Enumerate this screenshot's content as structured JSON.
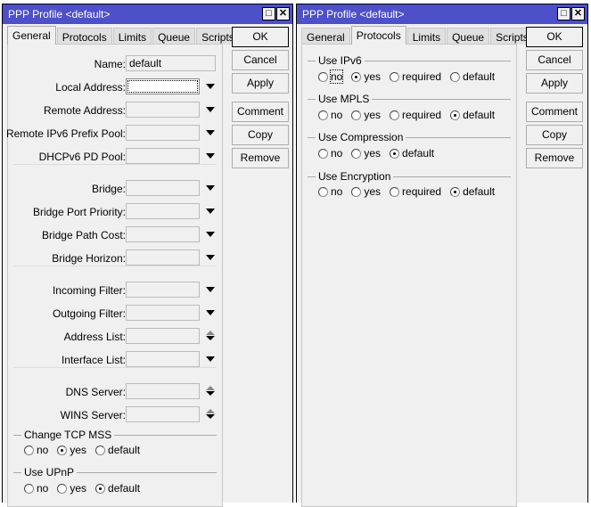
{
  "windows": [
    {
      "title": "PPP Profile <default>",
      "tabs": [
        "General",
        "Protocols",
        "Limits",
        "Queue",
        "Scripts"
      ],
      "active_tab": 0
    },
    {
      "title": "PPP Profile <default>",
      "tabs": [
        "General",
        "Protocols",
        "Limits",
        "Queue",
        "Scripts"
      ],
      "active_tab": 1
    }
  ],
  "buttons": [
    "OK",
    "Cancel",
    "Apply",
    "Comment",
    "Copy",
    "Remove"
  ],
  "title_buttons": {
    "maximize": "□",
    "close": "✕"
  },
  "general": {
    "fields": [
      {
        "label": "Name:",
        "value": "default",
        "kind": "text"
      },
      {
        "label": "Local Address:",
        "value": "",
        "kind": "dropdown",
        "focused": true
      },
      {
        "label": "Remote Address:",
        "value": "",
        "kind": "dropdown"
      },
      {
        "label": "Remote IPv6 Prefix Pool:",
        "value": "",
        "kind": "dropdown"
      },
      {
        "label": "DHCPv6 PD Pool:",
        "value": "",
        "kind": "dropdown"
      },
      {
        "sep": true
      },
      {
        "label": "Bridge:",
        "value": "",
        "kind": "dropdown"
      },
      {
        "label": "Bridge Port Priority:",
        "value": "",
        "kind": "dropdown"
      },
      {
        "label": "Bridge Path Cost:",
        "value": "",
        "kind": "dropdown"
      },
      {
        "label": "Bridge Horizon:",
        "value": "",
        "kind": "dropdown"
      },
      {
        "sep": true
      },
      {
        "label": "Incoming Filter:",
        "value": "",
        "kind": "dropdown"
      },
      {
        "label": "Outgoing Filter:",
        "value": "",
        "kind": "dropdown"
      },
      {
        "label": "Address List:",
        "value": "",
        "kind": "updown"
      },
      {
        "label": "Interface List:",
        "value": "",
        "kind": "dropdown"
      },
      {
        "sep": true
      },
      {
        "label": "DNS Server:",
        "value": "",
        "kind": "updown"
      },
      {
        "label": "WINS Server:",
        "value": "",
        "kind": "updown"
      }
    ],
    "groups": [
      {
        "title": "Change TCP MSS",
        "options": [
          "no",
          "yes",
          "default"
        ],
        "selected": "yes"
      },
      {
        "title": "Use UPnP",
        "options": [
          "no",
          "yes",
          "default"
        ],
        "selected": "default"
      }
    ]
  },
  "protocols": {
    "groups": [
      {
        "title": "Use IPv6",
        "options": [
          "no",
          "yes",
          "required",
          "default"
        ],
        "selected": "yes",
        "focused": "no"
      },
      {
        "title": "Use MPLS",
        "options": [
          "no",
          "yes",
          "required",
          "default"
        ],
        "selected": "default"
      },
      {
        "title": "Use Compression",
        "options": [
          "no",
          "yes",
          "default"
        ],
        "selected": "default"
      },
      {
        "title": "Use Encryption",
        "options": [
          "no",
          "yes",
          "required",
          "default"
        ],
        "selected": "default"
      }
    ]
  }
}
